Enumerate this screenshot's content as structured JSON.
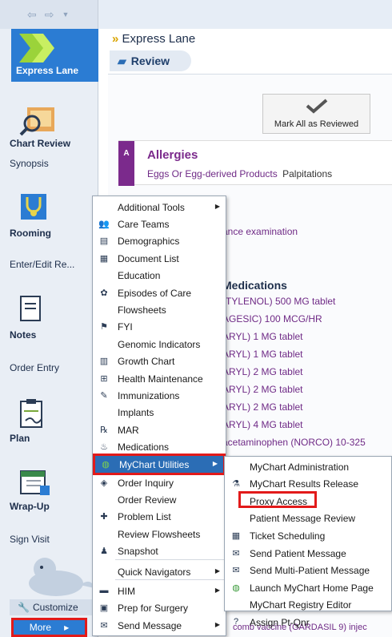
{
  "sidebar": {
    "express_lane": "Express Lane",
    "chart_review": "Chart Review",
    "synopsis": "Synopsis",
    "rooming": "Rooming",
    "enter_edit": "Enter/Edit Re...",
    "notes": "Notes",
    "order_entry": "Order Entry",
    "plan": "Plan",
    "wrap_up": "Wrap-Up",
    "sign_visit": "Sign Visit",
    "customize": "Customize",
    "more": "More"
  },
  "main": {
    "section_title": "Express Lane",
    "review_tab": "Review",
    "mark_all": "Mark All as Reviewed",
    "allergies_title": "Allergies",
    "allergies_items": [
      "Eggs Or Egg-derived Products",
      "Palpitations"
    ],
    "partial_line": "ance examination",
    "medications_title": "Medications",
    "medication_lines": [
      "(TYLENOL) 500 MG tablet",
      "AGESIC) 100 MCG/HR",
      "ARYL) 1 MG tablet",
      "ARYL) 1 MG tablet",
      "ARYL) 2 MG tablet",
      "ARYL) 2 MG tablet",
      "ARYL) 2 MG tablet",
      "ARYL) 4 MG tablet",
      "acetaminophen (NORCO) 10-325"
    ],
    "bottom_partial": "comb vaccine (GARDASIL 9) injec"
  },
  "more_menu": {
    "items": [
      {
        "label": "Additional Tools",
        "icon": "none",
        "submenu": true
      },
      {
        "label": "Care Teams",
        "icon": "people-icon",
        "submenu": false
      },
      {
        "label": "Demographics",
        "icon": "id-card-icon",
        "submenu": false
      },
      {
        "label": "Document List",
        "icon": "document-icon",
        "submenu": false
      },
      {
        "label": "Education",
        "icon": "none",
        "submenu": false
      },
      {
        "label": "Episodes of Care",
        "icon": "episodes-icon",
        "submenu": false
      },
      {
        "label": "Flowsheets",
        "icon": "none",
        "submenu": false
      },
      {
        "label": "FYI",
        "icon": "flag-icon",
        "submenu": false
      },
      {
        "label": "Genomic Indicators",
        "icon": "none",
        "submenu": false
      },
      {
        "label": "Growth Chart",
        "icon": "chart-icon",
        "submenu": false
      },
      {
        "label": "Health Maintenance",
        "icon": "plus-box-icon",
        "submenu": false
      },
      {
        "label": "Immunizations",
        "icon": "syringe-icon",
        "submenu": false
      },
      {
        "label": "Implants",
        "icon": "none",
        "submenu": false
      },
      {
        "label": "MAR",
        "icon": "mar-icon",
        "submenu": false
      },
      {
        "label": "Medications",
        "icon": "medications-icon",
        "submenu": false
      },
      {
        "label": "MyChart Utilities",
        "icon": "globe-icon",
        "submenu": true
      },
      {
        "label": "Order Inquiry",
        "icon": "order-icon",
        "submenu": false
      },
      {
        "label": "Order Review",
        "icon": "none",
        "submenu": false
      },
      {
        "label": "Problem List",
        "icon": "problem-icon",
        "submenu": false
      },
      {
        "label": "Review Flowsheets",
        "icon": "none",
        "submenu": false
      },
      {
        "label": "Snapshot",
        "icon": "person-icon",
        "submenu": false
      },
      {
        "label": "Quick Navigators",
        "icon": "none",
        "submenu": true
      },
      {
        "label": "HIM",
        "icon": "him-icon",
        "submenu": true
      },
      {
        "label": "Prep for Surgery",
        "icon": "clipboard-icon",
        "submenu": false
      },
      {
        "label": "Send Message",
        "icon": "message-icon",
        "submenu": true
      }
    ]
  },
  "mychart_menu": {
    "items": [
      {
        "label": "MyChart Administration",
        "icon": "none"
      },
      {
        "label": "MyChart Results Release",
        "icon": "results-icon"
      },
      {
        "label": "Proxy Access",
        "icon": "none"
      },
      {
        "label": "Patient Message Review",
        "icon": "none"
      },
      {
        "label": "Ticket Scheduling",
        "icon": "calendar-icon"
      },
      {
        "label": "Send Patient Message",
        "icon": "envelope-icon"
      },
      {
        "label": "Send Multi-Patient Message",
        "icon": "envelope-icon"
      },
      {
        "label": "Launch MyChart Home Page",
        "icon": "globe-icon"
      },
      {
        "label": "MyChart Registry Editor",
        "icon": "none"
      },
      {
        "label": "Assign Pt-Qnr",
        "icon": "question-icon"
      }
    ]
  },
  "colors": {
    "highlight": "#2b6db5",
    "annotation_red": "#e21a1a",
    "purple_text": "#6f2a86",
    "sidebar_blue": "#2b7cd3"
  }
}
